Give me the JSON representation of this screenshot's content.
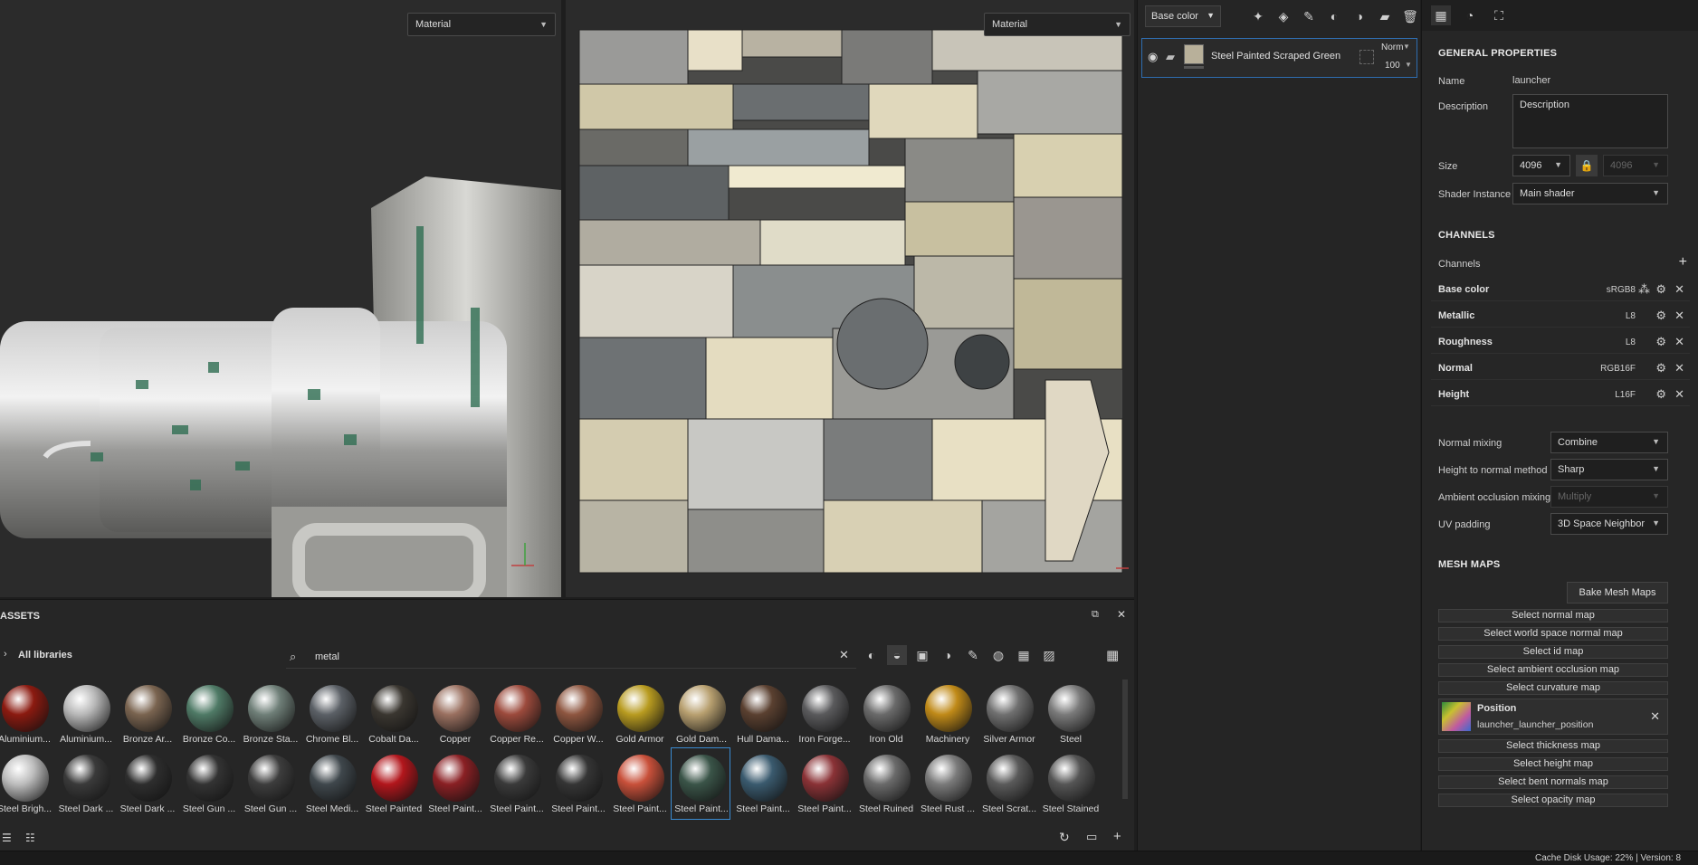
{
  "viewport3d": {
    "material_label": "Material"
  },
  "viewport2d": {
    "material_label": "Material"
  },
  "layers": {
    "channel_select": "Base color",
    "layer": {
      "name": "Steel Painted Scraped Green",
      "blend": "Norm",
      "opacity": "100"
    }
  },
  "properties": {
    "general_title": "GENERAL PROPERTIES",
    "name_label": "Name",
    "name_value": "launcher",
    "description_label": "Description",
    "description_value": "Description",
    "size_label": "Size",
    "size_value": "4096",
    "size_locked_value": "4096",
    "shader_label": "Shader Instance",
    "shader_value": "Main shader",
    "channels_title": "CHANNELS",
    "channels_label": "Channels",
    "channels": [
      {
        "name": "Base color",
        "format": "sRGB8"
      },
      {
        "name": "Metallic",
        "format": "L8"
      },
      {
        "name": "Roughness",
        "format": "L8"
      },
      {
        "name": "Normal",
        "format": "RGB16F"
      },
      {
        "name": "Height",
        "format": "L16F"
      }
    ],
    "normal_mixing_label": "Normal mixing",
    "normal_mixing_value": "Combine",
    "height_to_normal_label": "Height to normal method",
    "height_to_normal_value": "Sharp",
    "ao_mixing_label": "Ambient occlusion mixing",
    "ao_mixing_value": "Multiply",
    "uv_padding_label": "UV padding",
    "uv_padding_value": "3D Space Neighbor",
    "mesh_maps_title": "MESH MAPS",
    "bake_button": "Bake Mesh Maps",
    "maps": [
      "Select normal map",
      "Select world space normal map",
      "Select id map",
      "Select ambient occlusion map",
      "Select curvature map"
    ],
    "position_map": {
      "title": "Position",
      "file": "launcher_launcher_position"
    },
    "maps_after": [
      "Select thickness map",
      "Select height map",
      "Select bent normals map",
      "Select opacity map"
    ]
  },
  "assets": {
    "title": "ASSETS",
    "libraries": "All libraries",
    "search_value": "metal",
    "row1": [
      {
        "label": "Aluminium...",
        "color": "#8b1a10"
      },
      {
        "label": "Aluminium...",
        "color": "#b8b8b8"
      },
      {
        "label": "Bronze Ar...",
        "color": "#7a6450"
      },
      {
        "label": "Bronze Co...",
        "color": "#4f7a66"
      },
      {
        "label": "Bronze Sta...",
        "color": "#6f7f78"
      },
      {
        "label": "Chrome Bl...",
        "color": "#5b6066"
      },
      {
        "label": "Cobalt Da...",
        "color": "#3a3630"
      },
      {
        "label": "Copper",
        "color": "#9a7060"
      },
      {
        "label": "Copper Re...",
        "color": "#9c4a3c"
      },
      {
        "label": "Copper W...",
        "color": "#8e5640"
      },
      {
        "label": "Gold Armor",
        "color": "#b89b20"
      },
      {
        "label": "Gold Dam...",
        "color": "#b8a070"
      },
      {
        "label": "Hull Dama...",
        "color": "#5a4030"
      },
      {
        "label": "Iron Forge...",
        "color": "#5a5a5c"
      },
      {
        "label": "Iron Old",
        "color": "#6a6a6a"
      },
      {
        "label": "Machinery",
        "color": "#c08a18"
      },
      {
        "label": "Silver Armor",
        "color": "#707070"
      },
      {
        "label": "Steel",
        "color": "#7a7a7a"
      }
    ],
    "row2": [
      {
        "label": "Steel Brigh...",
        "color": "#bdbdbd"
      },
      {
        "label": "Steel Dark ...",
        "color": "#3a3a3a"
      },
      {
        "label": "Steel Dark ...",
        "color": "#2e2e2e"
      },
      {
        "label": "Steel Gun ...",
        "color": "#333333"
      },
      {
        "label": "Steel Gun ...",
        "color": "#3d3d3d"
      },
      {
        "label": "Steel Medi...",
        "color": "#3f474c"
      },
      {
        "label": "Steel Painted",
        "color": "#b2161c"
      },
      {
        "label": "Steel Paint...",
        "color": "#8a2024"
      },
      {
        "label": "Steel Paint...",
        "color": "#3a3a3a"
      },
      {
        "label": "Steel Paint...",
        "color": "#353535"
      },
      {
        "label": "Steel Paint...",
        "color": "#c8503a"
      },
      {
        "label": "Steel Paint...",
        "color": "#3a5448"
      },
      {
        "label": "Steel Paint...",
        "color": "#3a5a6e"
      },
      {
        "label": "Steel Paint...",
        "color": "#8a3236"
      },
      {
        "label": "Steel Ruined",
        "color": "#6a6a6a"
      },
      {
        "label": "Steel Rust ...",
        "color": "#7a7a7a"
      },
      {
        "label": "Steel Scrat...",
        "color": "#5a5a5a"
      },
      {
        "label": "Steel Stained",
        "color": "#555555"
      }
    ]
  },
  "status": {
    "text": "Cache Disk Usage:   22% | Version: 8"
  }
}
